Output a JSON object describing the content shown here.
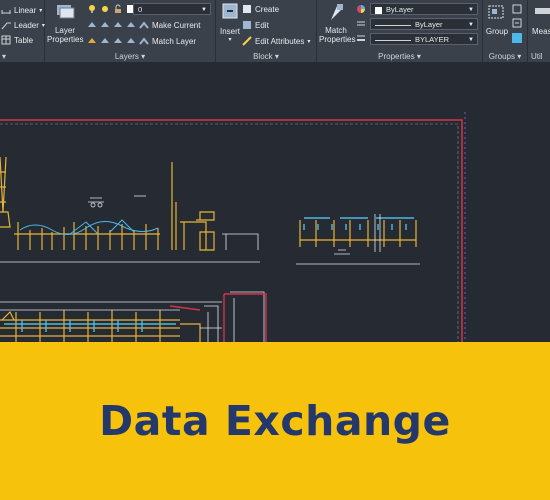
{
  "ribbon": {
    "annotation": {
      "linear_label": "Linear",
      "leader_label": "Leader",
      "table_label": "Table"
    },
    "layers": {
      "layer_properties_label": "Layer\nProperties",
      "layer_combo_value": "0",
      "make_current_label": "Make Current",
      "match_layer_label": "Match Layer",
      "panel_title": "Layers"
    },
    "block": {
      "insert_label": "Insert",
      "create_label": "Create",
      "edit_label": "Edit",
      "edit_attributes_label": "Edit Attributes",
      "panel_title": "Block"
    },
    "properties": {
      "match_properties_label": "Match\nProperties",
      "color_value": "ByLayer",
      "linetype_value": "ByLayer",
      "lineweight_value": "BYLAYER",
      "panel_title": "Properties"
    },
    "groups": {
      "group_label": "Group",
      "panel_title": "Groups"
    },
    "utilities": {
      "measure_label": "Meas",
      "panel_title": "Util"
    }
  },
  "banner": {
    "title": "Data Exchange",
    "background": "#f7c20c",
    "text_color": "#25386b"
  },
  "colors": {
    "ribbon_bg": "#3b414a",
    "canvas_bg": "#252a33",
    "drawing_yellow": "#e6b43a",
    "drawing_cyan": "#4fb7e8",
    "border_red": "#d2344a"
  }
}
